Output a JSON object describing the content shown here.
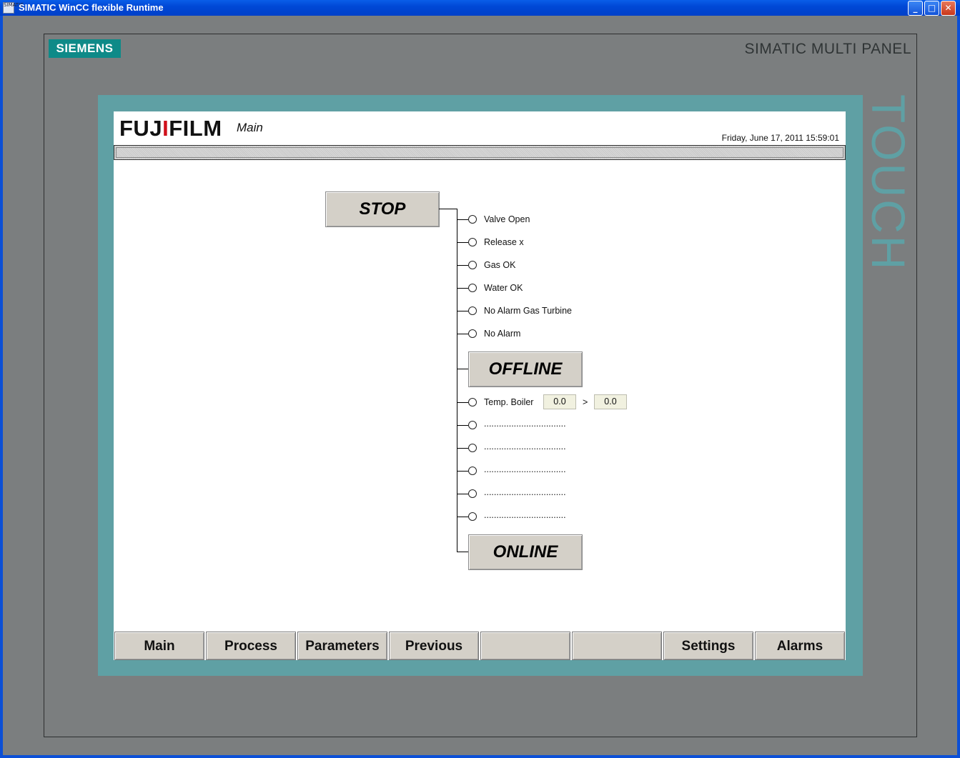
{
  "window": {
    "icon_label": "SIMATIC",
    "title": "SIMATIC WinCC flexible Runtime",
    "minimize_glyph": "_",
    "maximize_glyph": "□",
    "close_glyph": "✕"
  },
  "device": {
    "brand": "SIEMENS",
    "model": "SIMATIC MULTI PANEL",
    "touch_label": "TOUCH"
  },
  "screen": {
    "logo_text": "FUJIFILM",
    "title": "Main",
    "datetime": "Friday, June 17, 2011 15:59:01"
  },
  "control": {
    "stop_label": "STOP",
    "offline_label": "OFFLINE",
    "online_label": "ONLINE",
    "conditions": [
      {
        "label": "Valve Open"
      },
      {
        "label": "Release x"
      },
      {
        "label": "Gas OK"
      },
      {
        "label": "Water OK"
      },
      {
        "label": "No Alarm Gas Turbine"
      },
      {
        "label": "No Alarm"
      }
    ],
    "temp": {
      "label": "Temp. Boiler",
      "value": "0.0",
      "operator": ">",
      "setpoint": "0.0"
    },
    "placeholders": [
      {
        "label": "................................."
      },
      {
        "label": "................................."
      },
      {
        "label": "................................."
      },
      {
        "label": "................................."
      },
      {
        "label": "................................."
      }
    ]
  },
  "nav": {
    "items": [
      {
        "label": "Main"
      },
      {
        "label": "Process"
      },
      {
        "label": "Parameters"
      },
      {
        "label": "Previous"
      },
      {
        "label": ""
      },
      {
        "label": ""
      },
      {
        "label": "Settings"
      },
      {
        "label": "Alarms"
      }
    ]
  }
}
